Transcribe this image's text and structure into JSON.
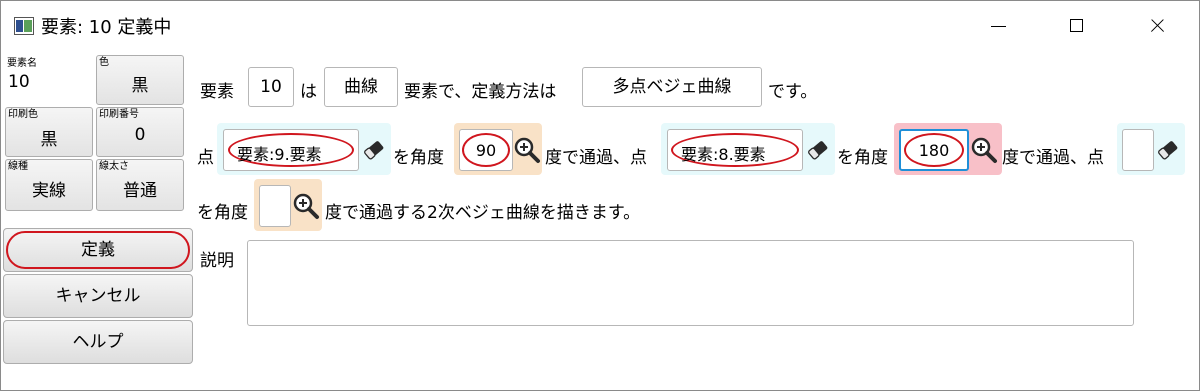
{
  "window": {
    "title": "要素: 10 定義中",
    "controls": {
      "minimize": "minimize",
      "maximize": "maximize",
      "close": "close"
    }
  },
  "sidebar": {
    "element_name": {
      "label": "要素名",
      "value": "10"
    },
    "color": {
      "label": "色",
      "value": "黒"
    },
    "print_color": {
      "label": "印刷色",
      "value": "黒"
    },
    "print_number": {
      "label": "印刷番号",
      "value": "0"
    },
    "line_type": {
      "label": "線種",
      "value": "実線"
    },
    "line_width": {
      "label": "線太さ",
      "value": "普通"
    }
  },
  "actions": {
    "define": "定義",
    "cancel": "キャンセル",
    "help": "ヘルプ"
  },
  "definition": {
    "line1": {
      "t_element": "要素",
      "element_value": "10",
      "t_wa": "は",
      "type_value": "曲線",
      "t_method": "要素で、定義方法は",
      "method_value": "多点ベジェ曲線",
      "t_desu": "です。"
    },
    "line2": {
      "t_point": "点",
      "point1_value": "要素:9.要素",
      "t_angle1": "を角度",
      "angle1_value": "90",
      "t_pass1": "度で通過、点",
      "point2_value": "要素:8.要素",
      "t_angle2": "を角度",
      "angle2_value": "180",
      "t_pass2": "度で通過、点",
      "point3_value": ""
    },
    "line3": {
      "t_angle3": "を角度",
      "angle3_value": "",
      "t_final": "度で通過する2次ベジェ曲線を描きます。"
    }
  },
  "description": {
    "label": "説明",
    "value": ""
  },
  "colors": {
    "highlight_red": "#d0161e",
    "focus_blue": "#1e8fd8",
    "cyan_bg": "#e6f9fb",
    "orange_bg": "#f9e2c7",
    "pink_bg": "#f8c0c8"
  }
}
